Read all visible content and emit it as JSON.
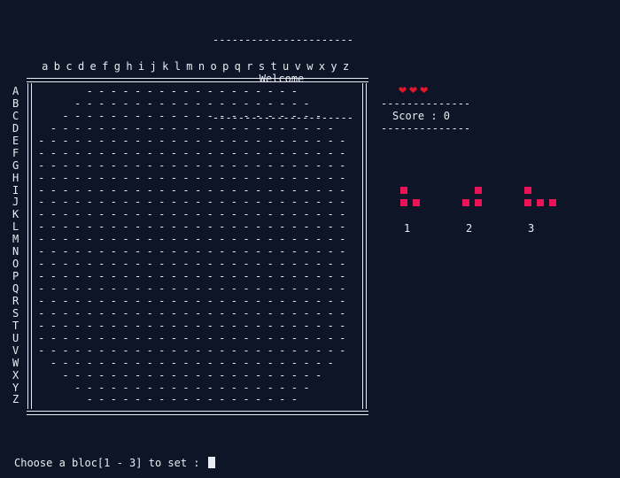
{
  "header": {
    "dashes_top": "----------------------",
    "title": "Welcome",
    "dashes_bottom": "----------------------"
  },
  "board": {
    "columns": [
      "a",
      "b",
      "c",
      "d",
      "e",
      "f",
      "g",
      "h",
      "i",
      "j",
      "k",
      "l",
      "m",
      "n",
      "o",
      "p",
      "q",
      "r",
      "s",
      "t",
      "u",
      "v",
      "w",
      "x",
      "y",
      "z"
    ],
    "rows": [
      "A",
      "B",
      "C",
      "D",
      "E",
      "F",
      "G",
      "H",
      "I",
      "J",
      "K",
      "L",
      "M",
      "N",
      "O",
      "P",
      "Q",
      "R",
      "S",
      "T",
      "U",
      "V",
      "W",
      "X",
      "Y",
      "Z"
    ],
    "empty_cell": "-",
    "row_spans": [
      [
        4,
        21
      ],
      [
        3,
        22
      ],
      [
        2,
        23
      ],
      [
        1,
        24
      ],
      [
        0,
        25
      ],
      [
        0,
        25
      ],
      [
        0,
        25
      ],
      [
        0,
        25
      ],
      [
        0,
        25
      ],
      [
        0,
        25
      ],
      [
        0,
        25
      ],
      [
        0,
        25
      ],
      [
        0,
        25
      ],
      [
        0,
        25
      ],
      [
        0,
        25
      ],
      [
        0,
        25
      ],
      [
        0,
        25
      ],
      [
        0,
        25
      ],
      [
        0,
        25
      ],
      [
        0,
        25
      ],
      [
        0,
        25
      ],
      [
        0,
        25
      ],
      [
        1,
        24
      ],
      [
        2,
        23
      ],
      [
        3,
        22
      ],
      [
        4,
        21
      ]
    ]
  },
  "status": {
    "lives": 3,
    "heart_icon": "❤",
    "heart_color": "#e8142a",
    "score_divider": "--------------",
    "score_label": "Score : 0"
  },
  "pieces": {
    "color": "#ec1456",
    "items": [
      {
        "label": "1",
        "cells": [
          [
            0,
            0
          ],
          [
            0,
            1
          ],
          [
            1,
            1
          ]
        ]
      },
      {
        "label": "2",
        "cells": [
          [
            1,
            0
          ],
          [
            0,
            1
          ],
          [
            1,
            1
          ]
        ]
      },
      {
        "label": "3",
        "cells": [
          [
            0,
            0
          ],
          [
            0,
            1
          ],
          [
            1,
            1
          ],
          [
            2,
            1
          ]
        ]
      }
    ]
  },
  "prompt": {
    "text": "Choose a bloc[1 - 3] to set :"
  }
}
